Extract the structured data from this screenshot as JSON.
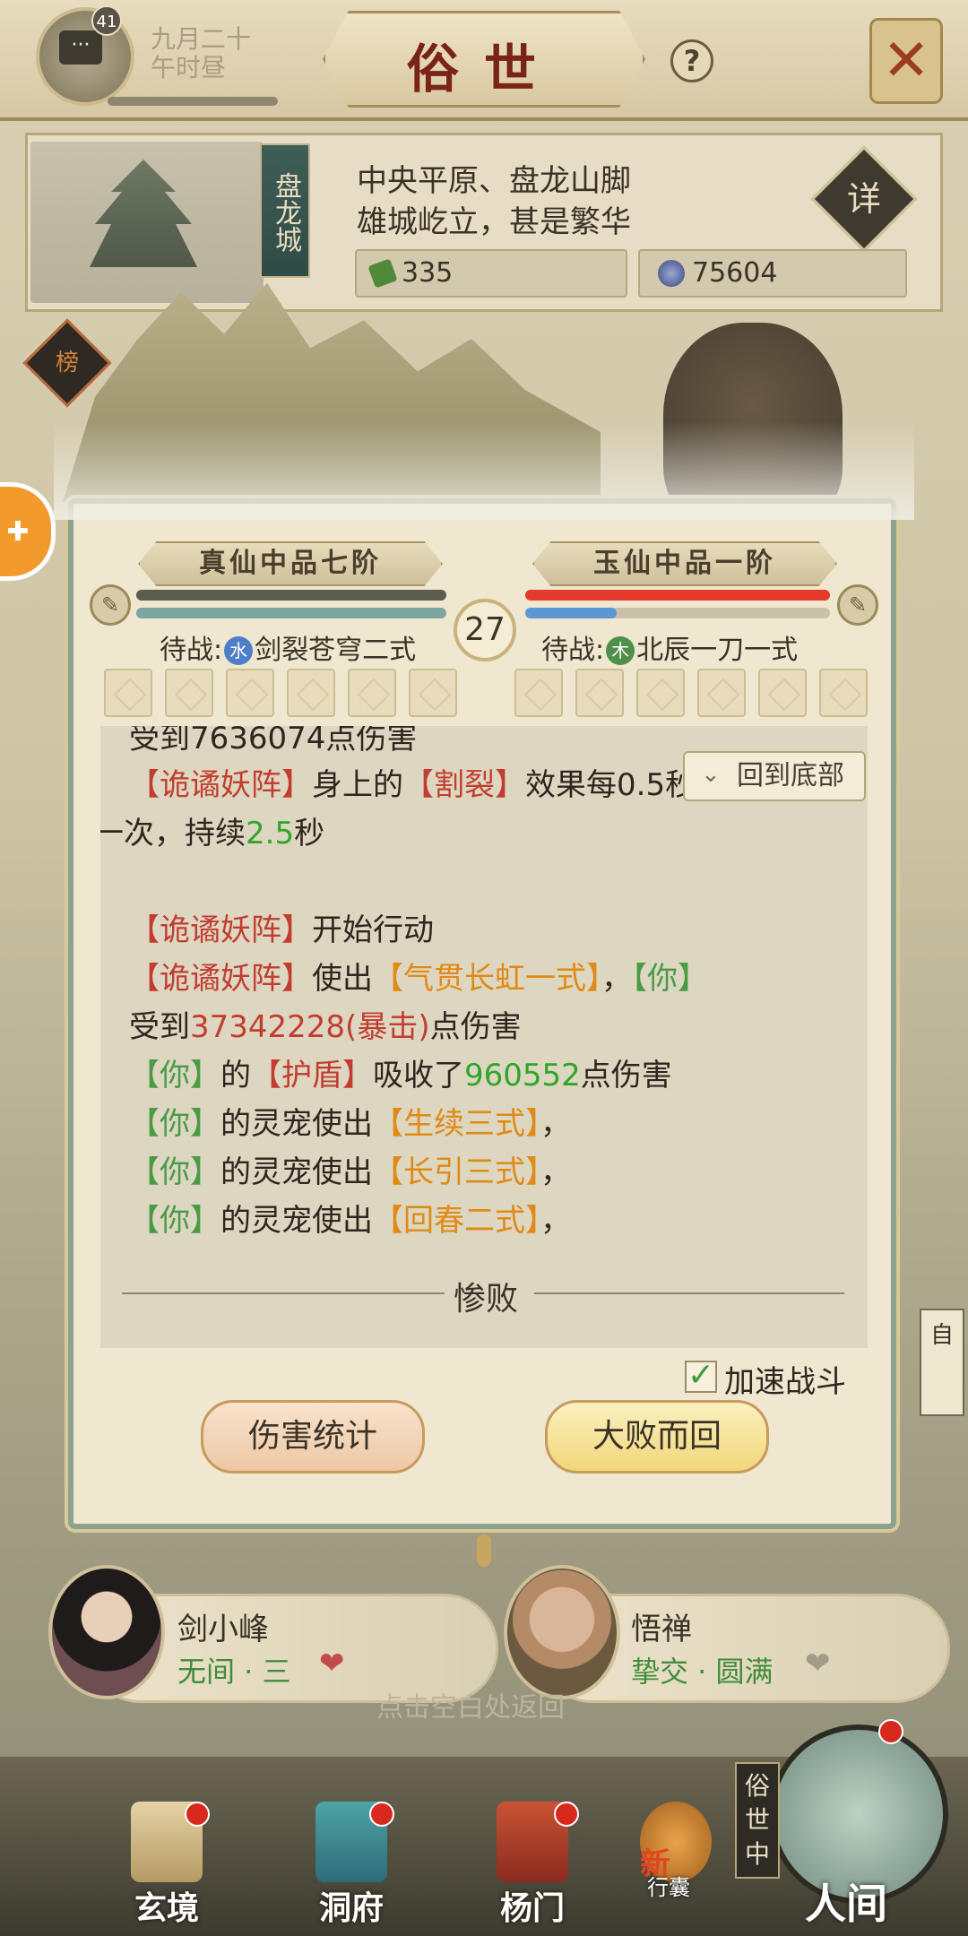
{
  "header": {
    "notification_count": "41",
    "date_line1": "九月二十",
    "date_line2": "午时昼",
    "title": "俗世",
    "help": "?",
    "close": "✕"
  },
  "location": {
    "city": "盘龙城",
    "line1": "中央平原、盘龙山脚",
    "line2": "雄城屹立，甚是繁华",
    "detail": "详",
    "resource1": "335",
    "resource2": "75604"
  },
  "side_tab": "榜",
  "battle": {
    "left_rank": "真仙中品七阶",
    "right_rank": "玉仙中品一阶",
    "round": "27",
    "left_hp_fraction": 1.0,
    "left_mp_fraction": 1.0,
    "right_hp_fraction": 1.0,
    "right_mp_fraction": 0.3,
    "left_waiting_prefix": "待战:",
    "left_waiting_elem": "水",
    "left_waiting_skill": "剑裂苍穹二式",
    "right_waiting_prefix": "待战:",
    "right_waiting_elem": "木",
    "right_waiting_skill": "北辰一刀一式",
    "back_to_bottom": "回到底部",
    "log": {
      "l0": "受到7636074点伤害",
      "l1_a": "【诡谲妖阵】",
      "l1_b": "身上的",
      "l1_c": "【割裂】",
      "l1_d": "效果每0.5秒生效",
      "l2_a": "一次，持续",
      "l2_b": "2.5",
      "l2_c": "秒",
      "l3_a": "【诡谲妖阵】",
      "l3_b": "开始行动",
      "l4_a": "【诡谲妖阵】",
      "l4_b": "使出",
      "l4_c": "【气贯长虹一式】",
      "l4_d": "，",
      "l4_e": "【你】",
      "l5_a": "受到",
      "l5_b": "37342228(暴击)",
      "l5_c": "点伤害",
      "l6_a": "【你】",
      "l6_b": "的",
      "l6_c": "【护盾】",
      "l6_d": "吸收了",
      "l6_e": "960552",
      "l6_f": "点伤害",
      "l7_a": "【你】",
      "l7_b": "的灵宠使出",
      "l7_c": "【生续三式】",
      "l7_d": "，",
      "l8_a": "【你】",
      "l8_b": "的灵宠使出",
      "l8_c": "【长引三式】",
      "l8_d": "，",
      "l9_a": "【你】",
      "l9_b": "的灵宠使出",
      "l9_c": "【回春二式】",
      "l9_d": "，"
    },
    "result": "惨败",
    "speed_label": "加速战斗",
    "speed_checked": true,
    "btn_stats": "伤害统计",
    "btn_retreat": "大败而回"
  },
  "contacts": [
    {
      "name": "剑小峰",
      "relation": "无间 · 三"
    },
    {
      "name": "悟禅",
      "relation": "挚交 · 圆满"
    }
  ],
  "hint": "点击空白处返回",
  "right_edge": "自",
  "nav": {
    "item1": "玄境",
    "item2": "洞府",
    "item3": "杨门",
    "bag_new": "新",
    "bag": "行囊",
    "world_tag": "俗世中",
    "world": "人间"
  },
  "colors": {
    "accent_red": "#c23d30",
    "skill_orange": "#e18a15",
    "ally_green": "#4a9b45",
    "hp_red": "#e53a2c",
    "mp_blue": "#5b96d6"
  }
}
